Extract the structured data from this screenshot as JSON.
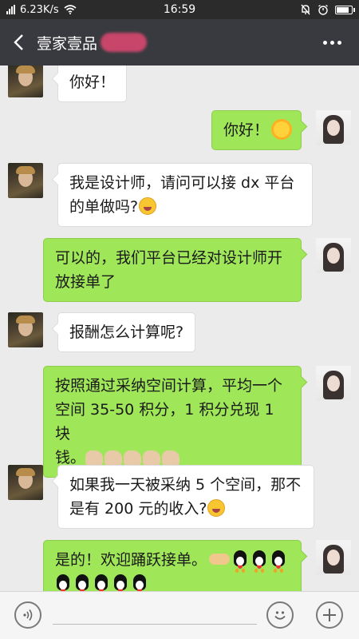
{
  "status_bar": {
    "network_speed": "6.23K/s",
    "time": "16:59"
  },
  "header": {
    "title": "壹家壹品"
  },
  "messages": [
    {
      "side": "left",
      "line1": "你好！",
      "line2": ""
    },
    {
      "side": "right",
      "line1": "你好！",
      "line2": ""
    },
    {
      "side": "left",
      "line1": "我是设计师，请问可以接 dx 平台",
      "line2": "的单做吗?"
    },
    {
      "side": "right",
      "line1": "可以的，我们平台已经对设计师开",
      "line2": "放接单了"
    },
    {
      "side": "left",
      "line1": "报酬怎么计算呢?",
      "line2": ""
    },
    {
      "side": "right",
      "line1": "按照通过采纳空间计算，平均一个",
      "line2": "空间 35-50 积分，1 积分兑现 1 块",
      "line3": "钱。"
    },
    {
      "side": "left",
      "line1": "如果我一天被采纳 5 个空间，那不",
      "line2": "是有 200 元的收入?"
    },
    {
      "side": "right",
      "line1": "是的！欢迎踊跃接单。"
    }
  ],
  "input_bar": {
    "voice_icon": "voice-icon",
    "emoji_icon": "emoji-icon",
    "plus_icon": "plus-icon"
  }
}
